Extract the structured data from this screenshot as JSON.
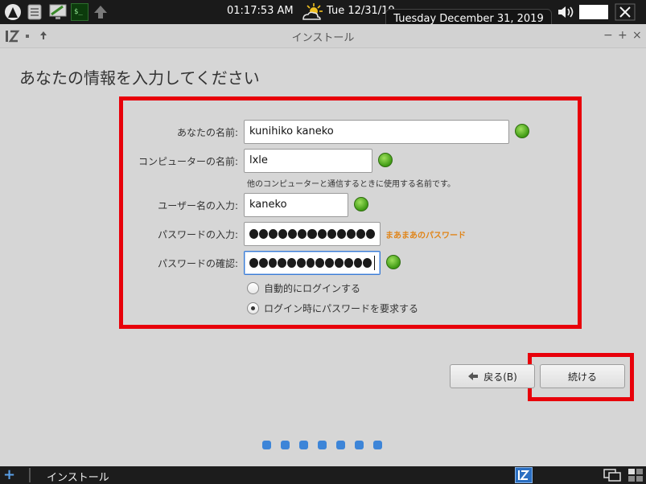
{
  "top_panel": {
    "clock": "01:17:53 AM",
    "date_short": "Tue 12/31/19",
    "date_tooltip": "Tuesday December 31, 2019",
    "terminal_prompt": "$_"
  },
  "window": {
    "title": "インストール",
    "controls": {
      "minimize": "−",
      "maximize": "+",
      "close": "×"
    }
  },
  "page": {
    "heading": "あなたの情報を入力してください"
  },
  "form": {
    "name_label": "あなたの名前:",
    "name_value": "kunihiko kaneko",
    "computer_label": "コンピューターの名前:",
    "computer_value": "lxle",
    "computer_hint": "他のコンピューターと通信するときに使用する名前です。",
    "username_label": "ユーザー名の入力:",
    "username_value": "kaneko",
    "password_label": "パスワードの入力:",
    "password_length": 13,
    "password_strength": "まあまあのパスワード",
    "confirm_label": "パスワードの確認:",
    "confirm_length": 13,
    "radio_auto_login": "自動的にログインする",
    "radio_require_password": "ログイン時にパスワードを要求する",
    "selected_radio": "require_password"
  },
  "buttons": {
    "back_label": "戻る(B)",
    "continue_label": "続ける"
  },
  "progress": {
    "total_steps": 7
  },
  "taskbar": {
    "plus": "+",
    "label": "インストール"
  },
  "colors": {
    "annotation_red": "#e8000a",
    "progress_blue": "#3d85d8",
    "strength_orange": "#e0851a",
    "ok_green": "#4caf1a"
  }
}
